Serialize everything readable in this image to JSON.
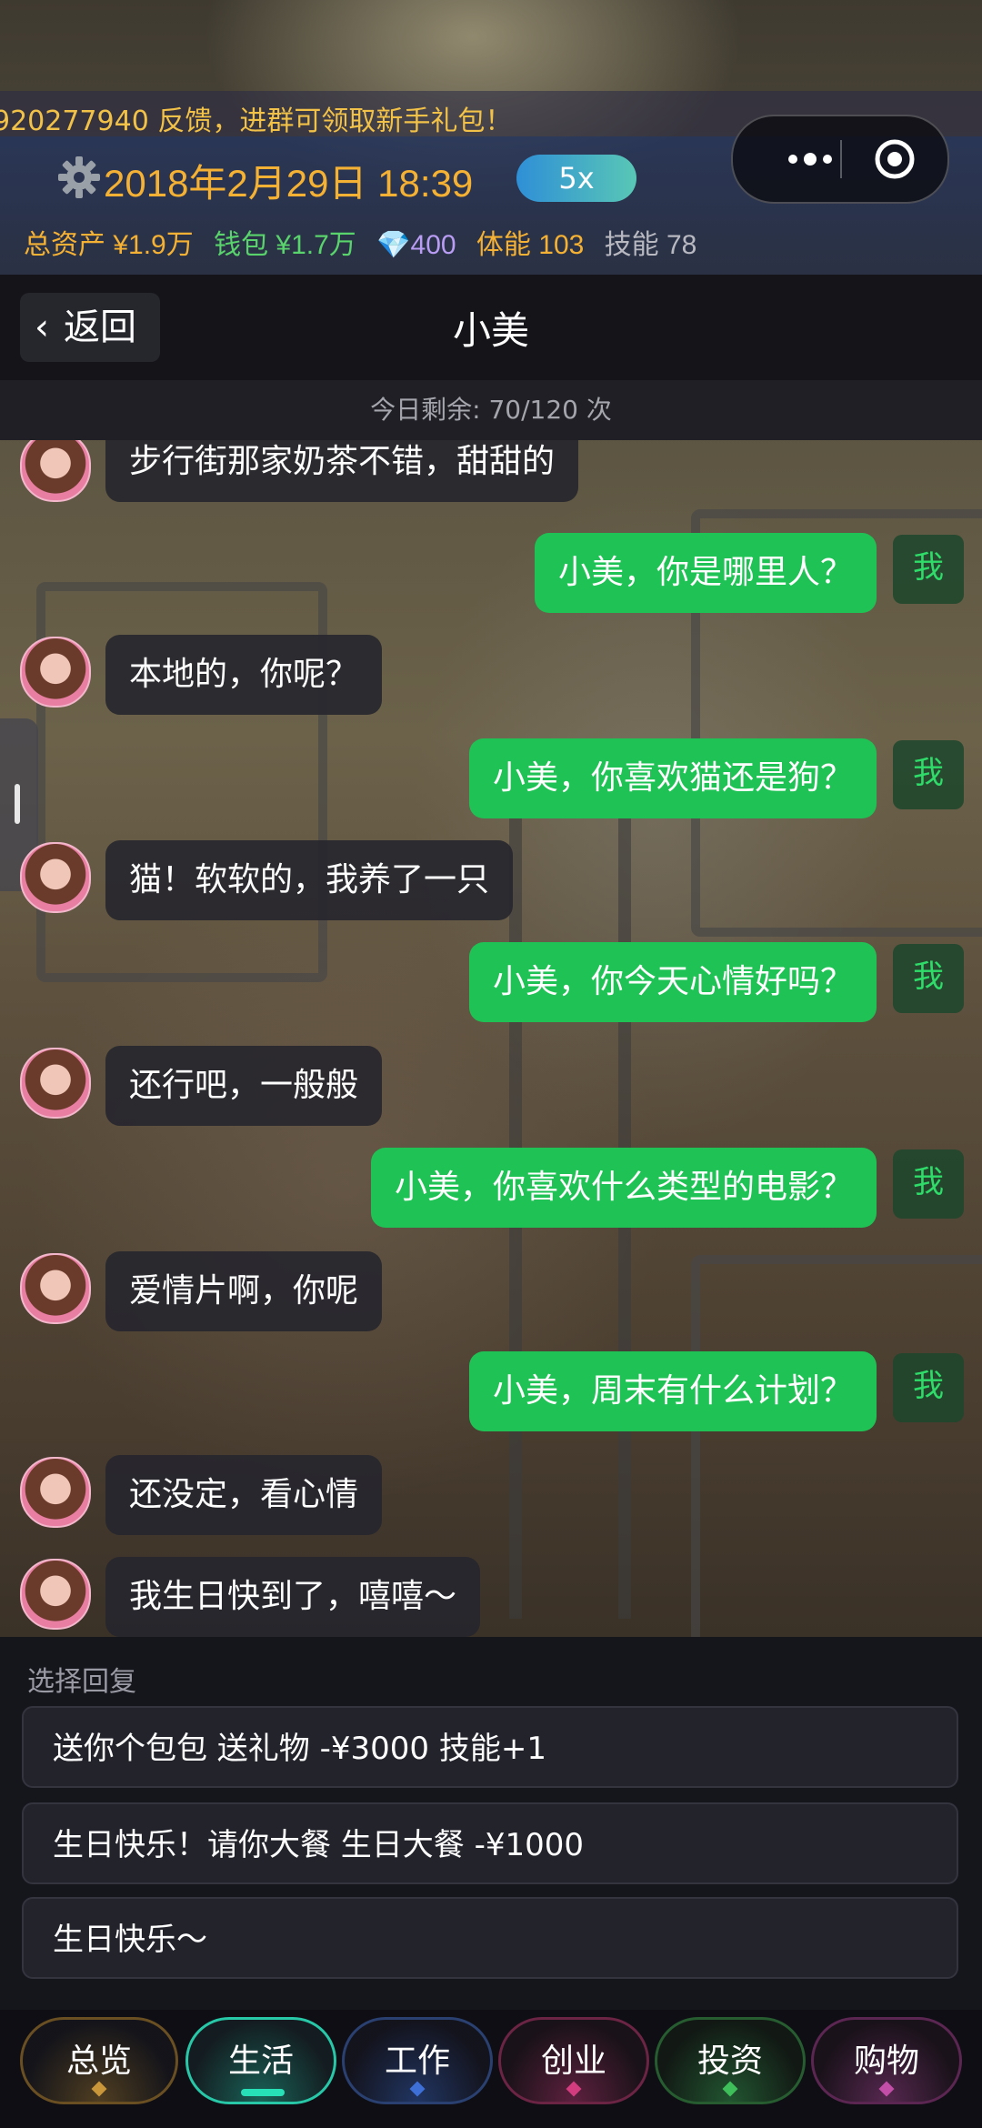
{
  "notice": "920277940 反馈，进群可领取新手礼包！",
  "status": {
    "datetime": "2018年2月29日 18:39",
    "speed": "5x",
    "total_assets": "总资产 ¥1.9万",
    "wallet": "钱包 ¥1.7万",
    "diamonds": "400",
    "stamina": "体能 103",
    "skill": "技能 78"
  },
  "colors": {
    "accent_gold": "#f5b133",
    "wallet_green": "#59d36b",
    "diamond_purple": "#b99cf3",
    "bubble_green": "#1fc254",
    "skill_gray": "#b8b8c0"
  },
  "nav": {
    "back": "返回",
    "title": "小美"
  },
  "quota": "今日剩余: 70/120 次",
  "me_tag": "我",
  "messages": [
    {
      "from": "her",
      "text": "步行街那家奶茶不错，甜甜的"
    },
    {
      "from": "me",
      "text": "小美，你是哪里人？"
    },
    {
      "from": "her",
      "text": "本地的，你呢？"
    },
    {
      "from": "me",
      "text": "小美，你喜欢猫还是狗？"
    },
    {
      "from": "her",
      "text": "猫！软软的，我养了一只"
    },
    {
      "from": "me",
      "text": "小美，你今天心情好吗？"
    },
    {
      "from": "her",
      "text": "还行吧，一般般"
    },
    {
      "from": "me",
      "text": "小美，你喜欢什么类型的电影？"
    },
    {
      "from": "her",
      "text": "爱情片啊，你呢"
    },
    {
      "from": "me",
      "text": "小美，周末有什么计划？"
    },
    {
      "from": "her",
      "text": "还没定，看心情"
    },
    {
      "from": "her",
      "text": "我生日快到了，嘻嘻～"
    }
  ],
  "reply": {
    "label": "选择回复",
    "options": [
      "送你个包包  送礼物 -¥3000 技能+1",
      "生日快乐！请你大餐  生日大餐 -¥1000",
      "生日快乐～"
    ]
  },
  "tabs": [
    {
      "label": "总览",
      "color": "#c9973a"
    },
    {
      "label": "生活",
      "color": "#27c7a7"
    },
    {
      "label": "工作",
      "color": "#3d6fd6"
    },
    {
      "label": "创业",
      "color": "#d33c7e"
    },
    {
      "label": "投资",
      "color": "#3fbf5a"
    },
    {
      "label": "购物",
      "color": "#c24ea8"
    }
  ]
}
